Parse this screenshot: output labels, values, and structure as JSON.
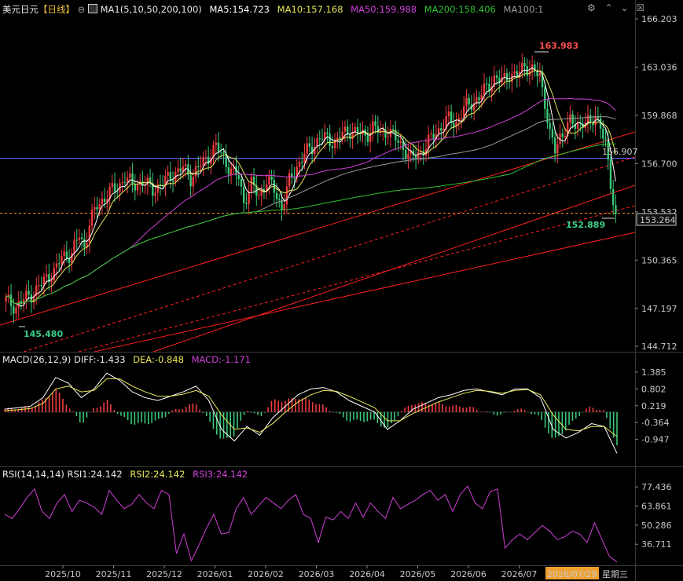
{
  "header": {
    "symbol": "美元日元",
    "period": "【日线】",
    "ma_title": "MA1(5,10,50,200,100)",
    "ma5": "MA5:154.723",
    "ma10": "MA10:157.168",
    "ma50": "MA50:159.988",
    "ma200": "MA200:158.406",
    "ma100": "MA100:1"
  },
  "macd_header": {
    "title": "MACD(26,12,9)",
    "diff": "DIFF:-1.433",
    "dea": "DEA:-0.848",
    "macd": "MACD:-1.171"
  },
  "rsi_header": {
    "title": "RSI(14,14,14)",
    "rsi1": "RSI1:24.142",
    "rsi2": "RSI2:24.142",
    "rsi3": "RSI3:24.142"
  },
  "annotations": {
    "high": "163.983",
    "low": "145.480",
    "recent_low": "152.889",
    "hline_value": "156.907",
    "current_price": "153.264"
  },
  "colors": {
    "up": "#f03c3c",
    "down": "#3cc878",
    "ma5": "#ffffff",
    "ma10": "#e8e85a",
    "ma50": "#d040d8",
    "ma200": "#30c030",
    "ma100": "#9a9a9a",
    "channel": "#ff2020",
    "hline": "#6a6aff",
    "dash": "#ff9a30"
  },
  "chart_data": [
    {
      "type": "candlestick",
      "title": "美元日元",
      "y_ticks": [
        "166.203",
        "163.036",
        "159.868",
        "156.700",
        "153.532",
        "150.365",
        "147.197",
        "144.712"
      ],
      "ylim": [
        144.712,
        166.203
      ],
      "x_ticks": [
        "2025/10",
        "2025/11",
        "2025/12",
        "2026/01",
        "2026/02",
        "2026/03",
        "2026/04",
        "2026/05",
        "2026/06",
        "2026/07"
      ],
      "cursor_date": "2026/07/29",
      "cursor_weekday": "星期三",
      "close_path": [
        [
          0,
          147.7
        ],
        [
          4,
          147.3
        ],
        [
          8,
          147.9
        ],
        [
          12,
          148.4
        ],
        [
          16,
          149.2
        ],
        [
          20,
          149.8
        ],
        [
          22,
          150.6
        ],
        [
          26,
          150.8
        ],
        [
          29,
          152.0
        ],
        [
          31,
          151.2
        ],
        [
          33,
          152.8
        ],
        [
          36,
          153.9
        ],
        [
          40,
          154.7
        ],
        [
          44,
          155.1
        ],
        [
          47,
          155.8
        ],
        [
          50,
          155.3
        ],
        [
          54,
          155.5
        ],
        [
          58,
          155.0
        ],
        [
          62,
          155.4
        ],
        [
          66,
          156.0
        ],
        [
          70,
          156.4
        ],
        [
          73,
          155.8
        ],
        [
          77,
          156.6
        ],
        [
          80,
          157.2
        ],
        [
          83,
          157.8
        ],
        [
          86,
          157.1
        ],
        [
          89,
          156.2
        ],
        [
          92,
          155.8
        ],
        [
          94,
          154.2
        ],
        [
          97,
          155.3
        ],
        [
          100,
          154.6
        ],
        [
          103,
          155.6
        ],
        [
          106,
          155.0
        ],
        [
          109,
          153.8
        ],
        [
          112,
          155.5
        ],
        [
          115,
          156.5
        ],
        [
          118,
          157.3
        ],
        [
          121,
          157.8
        ],
        [
          124,
          158.4
        ],
        [
          127,
          158.3
        ],
        [
          130,
          158.1
        ],
        [
          133,
          158.6
        ],
        [
          136,
          158.9
        ],
        [
          139,
          158.7
        ],
        [
          142,
          158.5
        ],
        [
          145,
          159.1
        ],
        [
          148,
          158.7
        ],
        [
          151,
          158.9
        ],
        [
          154,
          158.3
        ],
        [
          157,
          157.8
        ],
        [
          160,
          157.0
        ],
        [
          163,
          157.4
        ],
        [
          166,
          157.8
        ],
        [
          169,
          158.6
        ],
        [
          172,
          159.1
        ],
        [
          175,
          159.6
        ],
        [
          178,
          159.4
        ],
        [
          181,
          160.3
        ],
        [
          184,
          160.7
        ],
        [
          187,
          161.0
        ],
        [
          190,
          161.7
        ],
        [
          193,
          162.3
        ],
        [
          196,
          162.1
        ],
        [
          199,
          162.6
        ],
        [
          202,
          162.4
        ],
        [
          205,
          163.2
        ],
        [
          208,
          162.8
        ],
        [
          211,
          162.4
        ],
        [
          213,
          160.8
        ],
        [
          215,
          158.6
        ],
        [
          217,
          157.5
        ],
        [
          219,
          158.5
        ],
        [
          221,
          159.0
        ],
        [
          223,
          159.4
        ],
        [
          225,
          159.2
        ],
        [
          228,
          159.5
        ],
        [
          231,
          159.2
        ],
        [
          233,
          159.9
        ],
        [
          235,
          159.3
        ],
        [
          237,
          157.8
        ],
        [
          239,
          155.3
        ],
        [
          241,
          153.3
        ]
      ],
      "markers": {
        "high": 163.983,
        "low": 145.48,
        "recent_low": 152.889,
        "hline": 156.907,
        "current": 153.264
      }
    },
    {
      "type": "line",
      "title": "MACD(26,12,9)",
      "y_ticks": [
        "1.385",
        "0.802",
        "0.219",
        "-0.364",
        "-0.947"
      ],
      "ylim": [
        -1.5,
        1.6
      ],
      "series": [
        {
          "name": "DIFF",
          "values": [
            0.1,
            0.15,
            0.2,
            0.5,
            1.2,
            1.0,
            0.5,
            0.8,
            1.35,
            1.1,
            0.7,
            0.5,
            0.4,
            0.55,
            0.7,
            0.9,
            0.4,
            -0.6,
            -1.0,
            -0.5,
            -0.8,
            -0.2,
            0.2,
            0.6,
            0.8,
            0.85,
            0.7,
            0.4,
            0.2,
            0.0,
            -0.6,
            -0.3,
            0.1,
            0.3,
            0.5,
            0.6,
            0.75,
            0.8,
            0.7,
            0.6,
            0.8,
            0.8,
            0.5,
            -0.6,
            -0.9,
            -0.7,
            -0.4,
            -0.5,
            -1.43
          ]
        },
        {
          "name": "DEA",
          "values": [
            0.05,
            0.08,
            0.12,
            0.3,
            0.8,
            0.9,
            0.7,
            0.75,
            1.15,
            1.15,
            0.9,
            0.7,
            0.55,
            0.55,
            0.62,
            0.75,
            0.55,
            -0.1,
            -0.6,
            -0.55,
            -0.7,
            -0.4,
            0.0,
            0.35,
            0.6,
            0.75,
            0.72,
            0.55,
            0.35,
            0.15,
            -0.3,
            -0.3,
            -0.05,
            0.15,
            0.35,
            0.5,
            0.65,
            0.75,
            0.72,
            0.65,
            0.75,
            0.78,
            0.6,
            -0.1,
            -0.6,
            -0.65,
            -0.5,
            -0.5,
            -0.85
          ]
        }
      ]
    },
    {
      "type": "line",
      "title": "RSI(14,14,14)",
      "y_ticks": [
        "77.436",
        "63.861",
        "50.286",
        "36.711"
      ],
      "ylim": [
        24,
        82
      ],
      "series": [
        {
          "name": "RSI1",
          "values": [
            58,
            55,
            62,
            70,
            76,
            60,
            55,
            66,
            72,
            60,
            68,
            66,
            63,
            58,
            75,
            68,
            62,
            65,
            72,
            66,
            62,
            75,
            72,
            30,
            44,
            25,
            36,
            48,
            58,
            44,
            45,
            62,
            70,
            58,
            64,
            70,
            66,
            62,
            68,
            72,
            58,
            55,
            38,
            56,
            54,
            60,
            55,
            66,
            56,
            66,
            60,
            55,
            70,
            62,
            65,
            68,
            72,
            75,
            68,
            72,
            60,
            72,
            78,
            66,
            62,
            74,
            76,
            34,
            40,
            44,
            40,
            45,
            50,
            46,
            40,
            42,
            46,
            44,
            38,
            52,
            40,
            28,
            24
          ]
        }
      ]
    }
  ]
}
